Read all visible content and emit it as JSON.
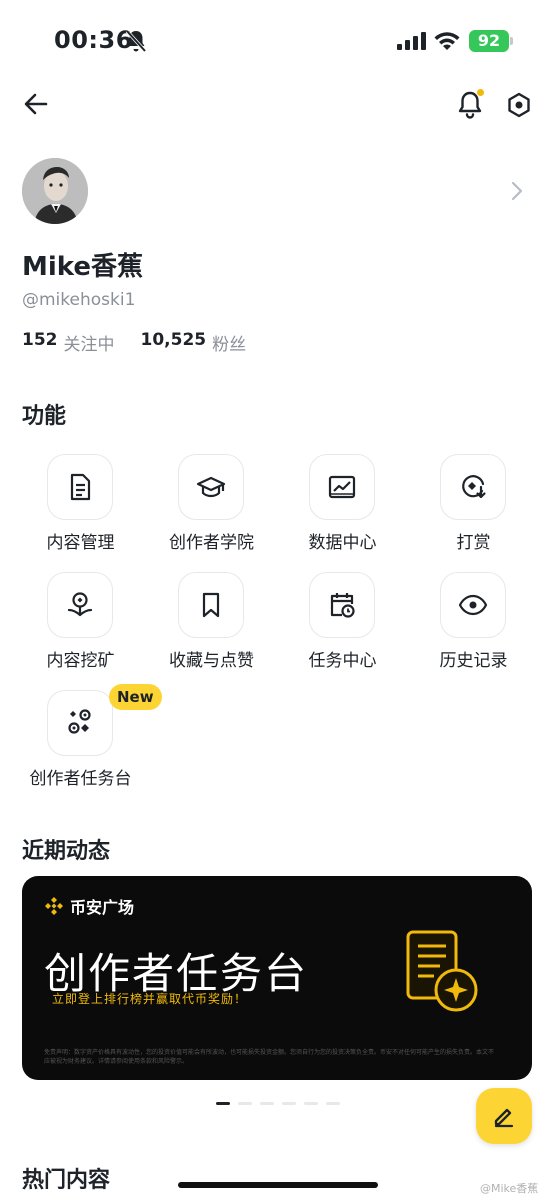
{
  "status_bar": {
    "time": "00:36",
    "battery": "92"
  },
  "profile": {
    "name": "Mike香蕉",
    "handle": "@mikehoski1",
    "following_count": "152",
    "following_label": "关注中",
    "followers_count": "10,525",
    "followers_label": "粉丝"
  },
  "features": {
    "title": "功能",
    "items": [
      {
        "label": "内容管理",
        "icon": "document-icon"
      },
      {
        "label": "创作者学院",
        "icon": "graduation-cap-icon"
      },
      {
        "label": "数据中心",
        "icon": "chart-icon"
      },
      {
        "label": "打赏",
        "icon": "tip-icon"
      },
      {
        "label": "内容挖矿",
        "icon": "mining-icon"
      },
      {
        "label": "收藏与点赞",
        "icon": "bookmark-icon"
      },
      {
        "label": "任务中心",
        "icon": "calendar-task-icon"
      },
      {
        "label": "历史记录",
        "icon": "eye-icon"
      },
      {
        "label": "创作者任务台",
        "icon": "task-board-icon",
        "badge": "New"
      }
    ]
  },
  "recent": {
    "title": "近期动态",
    "banner": {
      "brand": "币安广场",
      "headline": "创作者任务台",
      "subtitle": "立即登上排行榜并赢取代币奖励！",
      "disclaimer": "免责声明：数字资产价格具有波动性，您的投资价值可能会有所波动，也可能损失投资金额。您须自行为您的投资决策负全责。币安不对任何可能产生的损失负责。本文不应被视为财务建议。详情请参阅使用条款和风险警示。"
    }
  },
  "hot": {
    "title": "热门内容"
  },
  "watermark": "@Mike香蕉",
  "colors": {
    "accent": "#fcd535",
    "brand_gold": "#f0b90b",
    "text_primary": "#1e2329",
    "text_secondary": "#8a8f98"
  }
}
